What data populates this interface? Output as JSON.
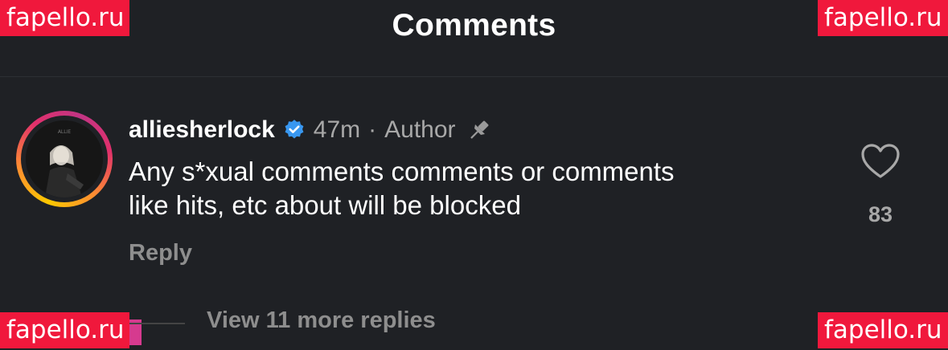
{
  "header": {
    "title": "Comments"
  },
  "watermarks": {
    "text": "fapello.ru"
  },
  "comment": {
    "username": "alliesherlock",
    "time": "47m",
    "separator": "·",
    "role": "Author",
    "text_line1": "Any s*xual comments comments or comments",
    "text_line2": "like hits, etc about will be blocked",
    "reply_label": "Reply",
    "like_count": "83",
    "avatar_caption": "ALLIE"
  },
  "replies": {
    "view_more_label": "View 11 more replies"
  },
  "colors": {
    "background": "#1f2125",
    "verified": "#3897f0",
    "watermark": "#f0183c",
    "muted": "#a8a8a8"
  },
  "icons": [
    "verified-badge-icon",
    "pin-icon",
    "heart-icon"
  ]
}
